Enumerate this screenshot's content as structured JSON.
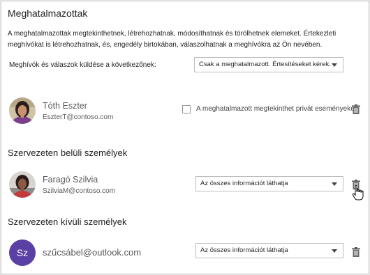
{
  "header": {
    "title": "Meghatalmazottak",
    "description": "A meghatalmazottak megtekinthetnek, létrehozhatnak, módosíthatnak és törölhetnek elemeket. Értekezleti meghívókat is létrehozhatnak, és, engedély birtokában, válaszolhatnak a meghívókra az Ön nevében."
  },
  "send_setting": {
    "label": "Meghívók és válaszok küldése a következőnek:",
    "selected": "Csak a meghatalmazott. Értesítéseket kérek."
  },
  "delegates": [
    {
      "name": "Tóth Eszter",
      "email": "EszterT@contoso.com",
      "private_label": "A meghatalmazott megtekinthet privát eseményeket",
      "private_checked": false
    }
  ],
  "inside_section": {
    "heading": "Szervezeten belüli személyek",
    "people": [
      {
        "name": "Faragó Szilvia",
        "email": "SzilviaM@contoso.com",
        "permission": "Az összes információt láthatja"
      }
    ]
  },
  "outside_section": {
    "heading": "Szervezeten kívüli személyek",
    "people": [
      {
        "initials": "Sz",
        "email": "szűcsábel@outlook.com",
        "permission": "Az összes információt láthatja"
      }
    ]
  },
  "colors": {
    "initials_avatar": "#5a3fa5",
    "text": "#1f1f1f",
    "muted": "#5a5a5a"
  }
}
